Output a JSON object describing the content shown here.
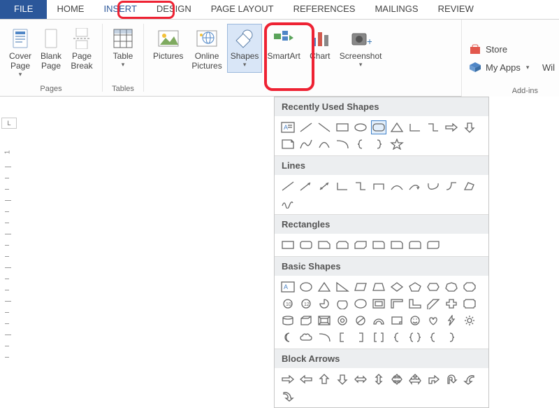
{
  "tabs": {
    "file": "FILE",
    "home": "HOME",
    "insert": "INSERT",
    "design": "DESIGN",
    "layout": "PAGE LAYOUT",
    "references": "REFERENCES",
    "mailings": "MAILINGS",
    "review": "REVIEW"
  },
  "ribbon": {
    "pages": {
      "cover": "Cover\nPage",
      "blank": "Blank\nPage",
      "break": "Page\nBreak",
      "label": "Pages"
    },
    "tables": {
      "table": "Table",
      "label": "Tables"
    },
    "illus": {
      "pictures": "Pictures",
      "online": "Online\nPictures",
      "shapes": "Shapes",
      "smartart": "SmartArt",
      "chart": "Chart",
      "screenshot": "Screenshot"
    }
  },
  "right": {
    "store": "Store",
    "myapps": "My Apps",
    "wiki": "Wil",
    "addins": "Add-ins"
  },
  "ruler": {
    "corner": "L",
    "n1": "1"
  },
  "menu": {
    "recent": "Recently Used Shapes",
    "lines": "Lines",
    "rects": "Rectangles",
    "basic": "Basic Shapes",
    "block": "Block Arrows"
  },
  "chart_data": null
}
